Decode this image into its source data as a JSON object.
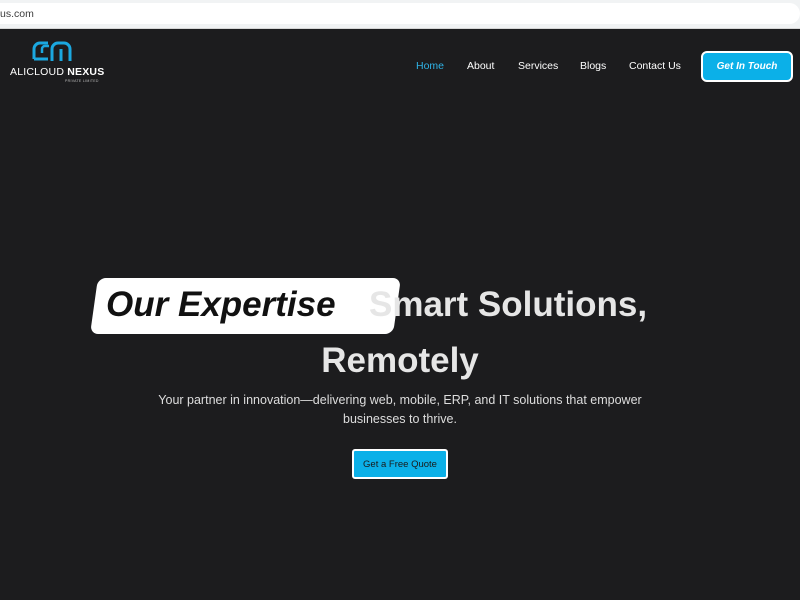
{
  "browser": {
    "url": "us.com"
  },
  "brand": {
    "name_light": "ALICLOUD ",
    "name_bold": "NEXUS",
    "tagline": "PRIVATE LIMITED",
    "accent_color": "#0bb0e8"
  },
  "nav": {
    "items": [
      {
        "label": "Home",
        "active": true
      },
      {
        "label": "About",
        "active": false
      },
      {
        "label": "Services",
        "active": false
      },
      {
        "label": "Blogs",
        "active": false
      },
      {
        "label": "Contact Us",
        "active": false
      }
    ],
    "cta_label": "Get In Touch"
  },
  "hero": {
    "highlight": "Our Expertise",
    "headline_rest": "Smart Solutions,",
    "headline_line2": "Remotely",
    "subtitle": "Your partner in innovation—delivering web, mobile, ERP, and IT solutions that empower businesses to thrive.",
    "cta_label": "Get a Free Quote"
  }
}
